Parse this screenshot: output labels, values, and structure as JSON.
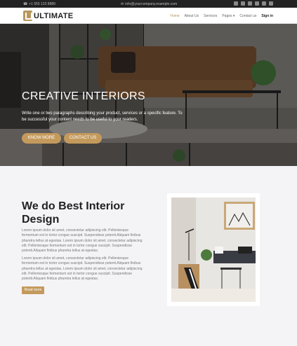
{
  "topbar": {
    "phone": "+1 555 123 8889",
    "email": "info@yourcompany.example.com",
    "social_icons": [
      "facebook-icon",
      "twitter-icon",
      "linkedin-icon",
      "youtube-icon",
      "instagram-icon",
      "github-icon"
    ]
  },
  "navbar": {
    "logo": "ULTIMATE",
    "items": [
      "Home",
      "About Us",
      "Services",
      "Pages",
      "Contact us",
      "Sign in"
    ],
    "active": "Home"
  },
  "hero": {
    "title": "CREATIVE INTERIORS",
    "description": "Write one or two paragraphs describing your product, services or a specific feature. To be successful your content needs to be useful to your readers.",
    "button_primary": "KNOW MORE",
    "button_secondary": "CONTACT US"
  },
  "about": {
    "title": "We do Best Interior Design",
    "paragraph1": "Lorem ipsum dolor sit amet, consectetur adipiscing elit. Pellentesque fermentum est in tortor congue suscipit. Suspendisse potenti.Aliquam finibus pharetra tellus at egestas. Lorem ipsum dolor sit amet, consectetur adipiscing elit. Pellentesque fermentum est in tortor congue suscipit. Suspendisse potenti.Aliquam finibus pharetra tellus at egestas.",
    "paragraph2": "Lorem ipsum dolor sit amet, consectetur adipiscing elit. Pellentesque fermentum est in tortor congue suscipit. Suspendisse potenti.Aliquam finibus pharetra tellus at egestas. Lorem ipsum dolor sit amet, consectetur adipiscing elit. Pellentesque fermentum est in tortor congue suscipit. Suspendisse potenti.Aliquam finibus pharetra tellus at egestas.",
    "button": "Read more"
  },
  "colors": {
    "accent": "#c49a5c",
    "topbar": "#222222",
    "background": "#f4f4f7"
  }
}
